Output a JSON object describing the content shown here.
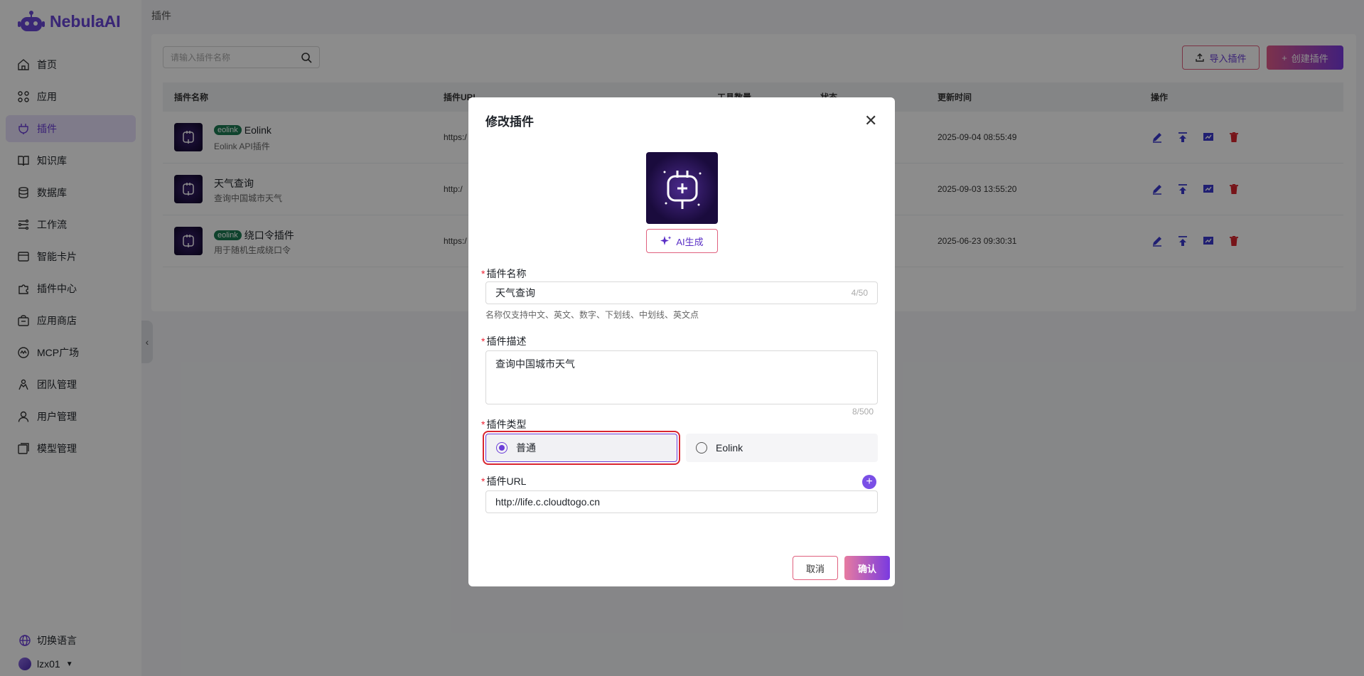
{
  "brand": {
    "name": "NebulaAI"
  },
  "sidebar": {
    "items": [
      {
        "label": "首页"
      },
      {
        "label": "应用"
      },
      {
        "label": "插件"
      },
      {
        "label": "知识库"
      },
      {
        "label": "数据库"
      },
      {
        "label": "工作流"
      },
      {
        "label": "智能卡片"
      },
      {
        "label": "插件中心"
      },
      {
        "label": "应用商店"
      },
      {
        "label": "MCP广场"
      },
      {
        "label": "团队管理"
      },
      {
        "label": "用户管理"
      },
      {
        "label": "模型管理"
      }
    ],
    "language_label": "切换语言",
    "username": "lzx01"
  },
  "breadcrumb": "插件",
  "toolbar": {
    "search_placeholder": "请输入插件名称",
    "import_label": "导入插件",
    "create_label": "创建插件"
  },
  "table": {
    "headers": [
      "插件名称",
      "插件URL",
      "工具数量",
      "状态",
      "更新时间",
      "操作"
    ],
    "rows": [
      {
        "tag": "eolink",
        "name": "Eolink",
        "desc": "Eolink API插件",
        "url": "https:/",
        "time": "2025-09-04 08:55:49"
      },
      {
        "tag": "",
        "name": "天气查询",
        "desc": "查询中国城市天气",
        "url": "http:/",
        "time": "2025-09-03 13:55:20"
      },
      {
        "tag": "eolink",
        "name": "绕口令插件",
        "desc": "用于随机生成绕口令",
        "url": "https:/",
        "time": "2025-06-23 09:30:31"
      }
    ]
  },
  "modal": {
    "title": "修改插件",
    "ai_label": "AI生成",
    "name_label": "插件名称",
    "name_value": "天气查询",
    "name_count": "4/50",
    "name_hint": "名称仅支持中文、英文、数字、下划线、中划线、英文点",
    "desc_label": "插件描述",
    "desc_value": "查询中国城市天气",
    "desc_count": "8/500",
    "type_label": "插件类型",
    "type_options": [
      "普通",
      "Eolink"
    ],
    "url_label": "插件URL",
    "url_value": "http://life.c.cloudtogo.cn",
    "cancel_label": "取消",
    "confirm_label": "确认"
  },
  "colors": {
    "accent": "#6b3ed8",
    "danger": "#d9262f"
  }
}
